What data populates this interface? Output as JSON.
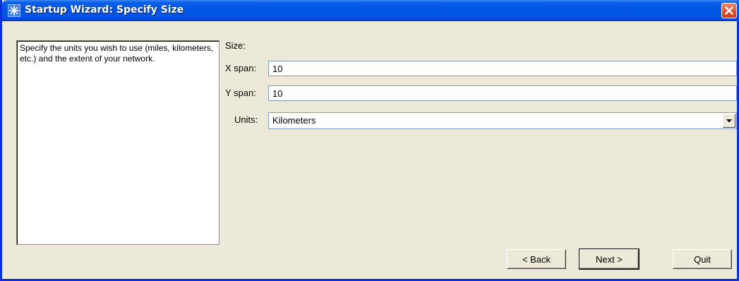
{
  "window": {
    "title": "Startup Wizard: Specify Size"
  },
  "help": {
    "text": "Specify the units you wish to use (miles, kilometers, etc.) and  the extent of your network."
  },
  "form": {
    "size_label": "Size:",
    "x_label": "X span:",
    "x_value": "10",
    "y_label": "Y span:",
    "y_value": "10",
    "units_label": "Units:",
    "units_value": "Kilometers"
  },
  "buttons": {
    "back": "< Back",
    "next": "Next >",
    "quit": "Quit"
  },
  "icons": {
    "app": "star-icon",
    "close": "close-icon",
    "dropdown": "chevron-down-icon"
  },
  "colors": {
    "titlebar": "#0054e3",
    "window_bg": "#ece9d8",
    "close_button": "#e0532d"
  }
}
